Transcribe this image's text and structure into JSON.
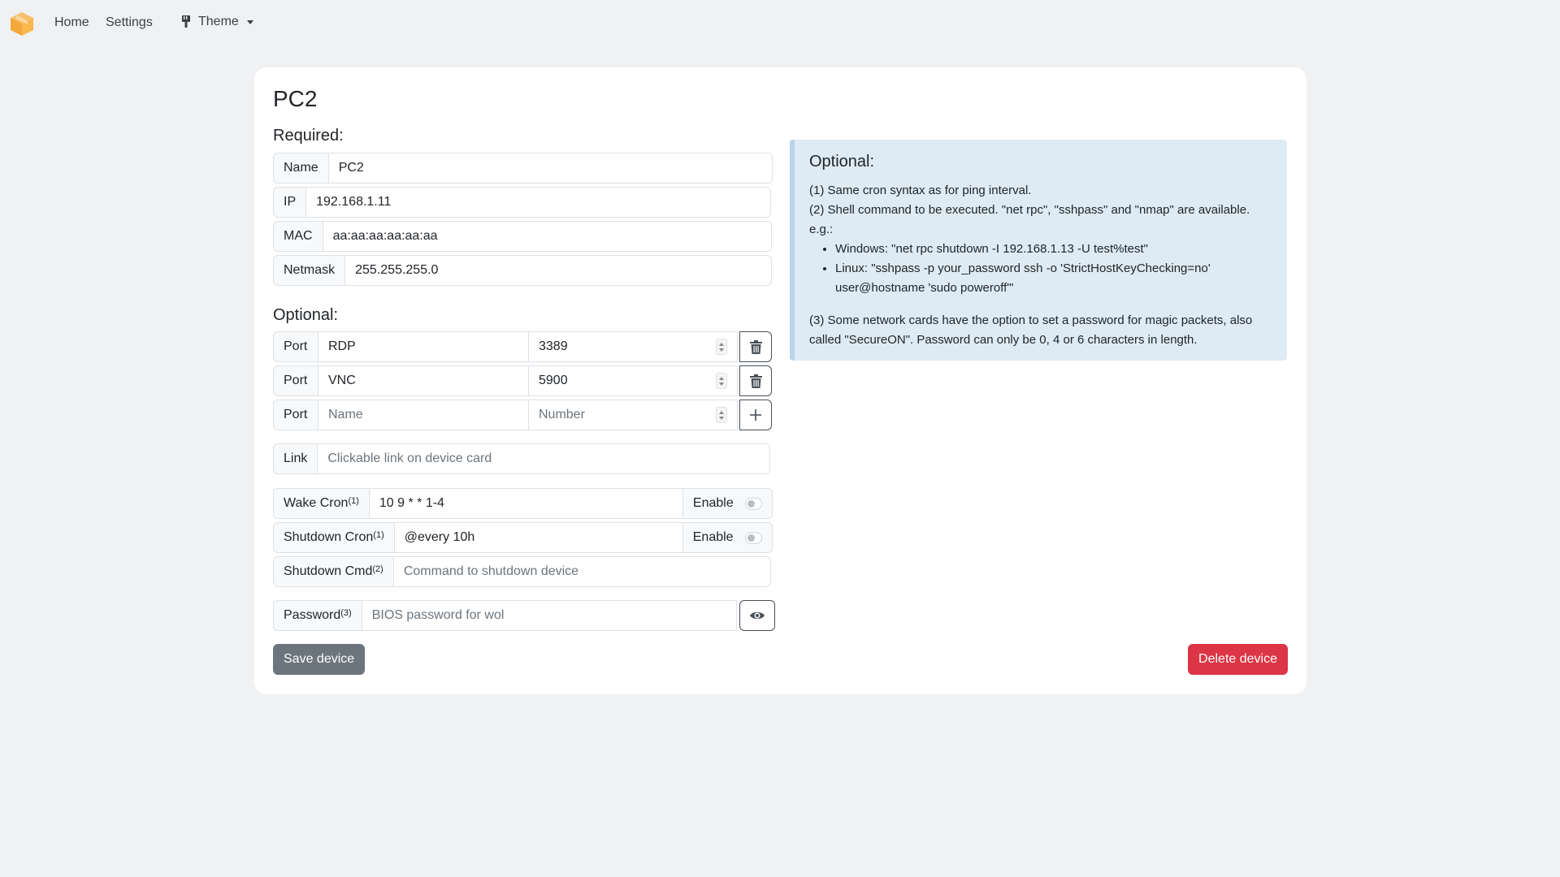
{
  "nav": {
    "home": "Home",
    "settings": "Settings",
    "theme": "Theme",
    "logo_icon": "box-logo",
    "theme_icon": "paintbrush-icon"
  },
  "page": {
    "title": "PC2",
    "required_label": "Required:",
    "optional_label": "Optional:"
  },
  "required": {
    "name": {
      "label": "Name",
      "value": "PC2"
    },
    "ip": {
      "label": "IP",
      "value": "192.168.1.11"
    },
    "mac": {
      "label": "MAC",
      "value": "aa:aa:aa:aa:aa:aa"
    },
    "netmask": {
      "label": "Netmask",
      "value": "255.255.255.0"
    }
  },
  "ports": [
    {
      "label": "Port",
      "name": "RDP",
      "number": "3389",
      "action_icon": "trash-icon"
    },
    {
      "label": "Port",
      "name": "VNC",
      "number": "5900",
      "action_icon": "trash-icon"
    },
    {
      "label": "Port",
      "name_placeholder": "Name",
      "number_placeholder": "Number",
      "action_icon": "plus-icon"
    }
  ],
  "link": {
    "label": "Link",
    "placeholder": "Clickable link on device card"
  },
  "wake_cron": {
    "label": "Wake Cron",
    "sup": "(1)",
    "value": "10 9 * * 1-4",
    "enable_label": "Enable",
    "enabled": false
  },
  "shutdown_cron": {
    "label": "Shutdown Cron",
    "sup": "(1)",
    "value": "@every 10h",
    "enable_label": "Enable",
    "enabled": false
  },
  "shutdown_cmd": {
    "label": "Shutdown Cmd",
    "sup": "(2)",
    "placeholder": "Command to shutdown device"
  },
  "password": {
    "label": "Password",
    "sup": "(3)",
    "placeholder": "BIOS password for wol",
    "toggle_icon": "eye-icon"
  },
  "buttons": {
    "save": "Save device",
    "delete": "Delete device"
  },
  "info": {
    "title": "Optional:",
    "line1": "(1) Same cron syntax as for ping interval.",
    "line2": "(2) Shell command to be executed. \"net rpc\", \"sshpass\" and \"nmap\" are available.",
    "line3": "e.g.:",
    "bullets": [
      "Windows: \"net rpc shutdown -I 192.168.1.13 -U test%test\"",
      "Linux: \"sshpass -p your_password ssh -o 'StrictHostKeyChecking=no' user@hostname 'sudo poweroff'\""
    ],
    "line4": "(3) Some network cards have the option to set a password for magic packets, also called \"SecureON\". Password can only be 0, 4 or 6 characters in length."
  },
  "colors": {
    "background": "#f0f1f3",
    "save_button": "#6c757d",
    "delete_button": "#dc3545",
    "info_bg": "#deebf5"
  }
}
